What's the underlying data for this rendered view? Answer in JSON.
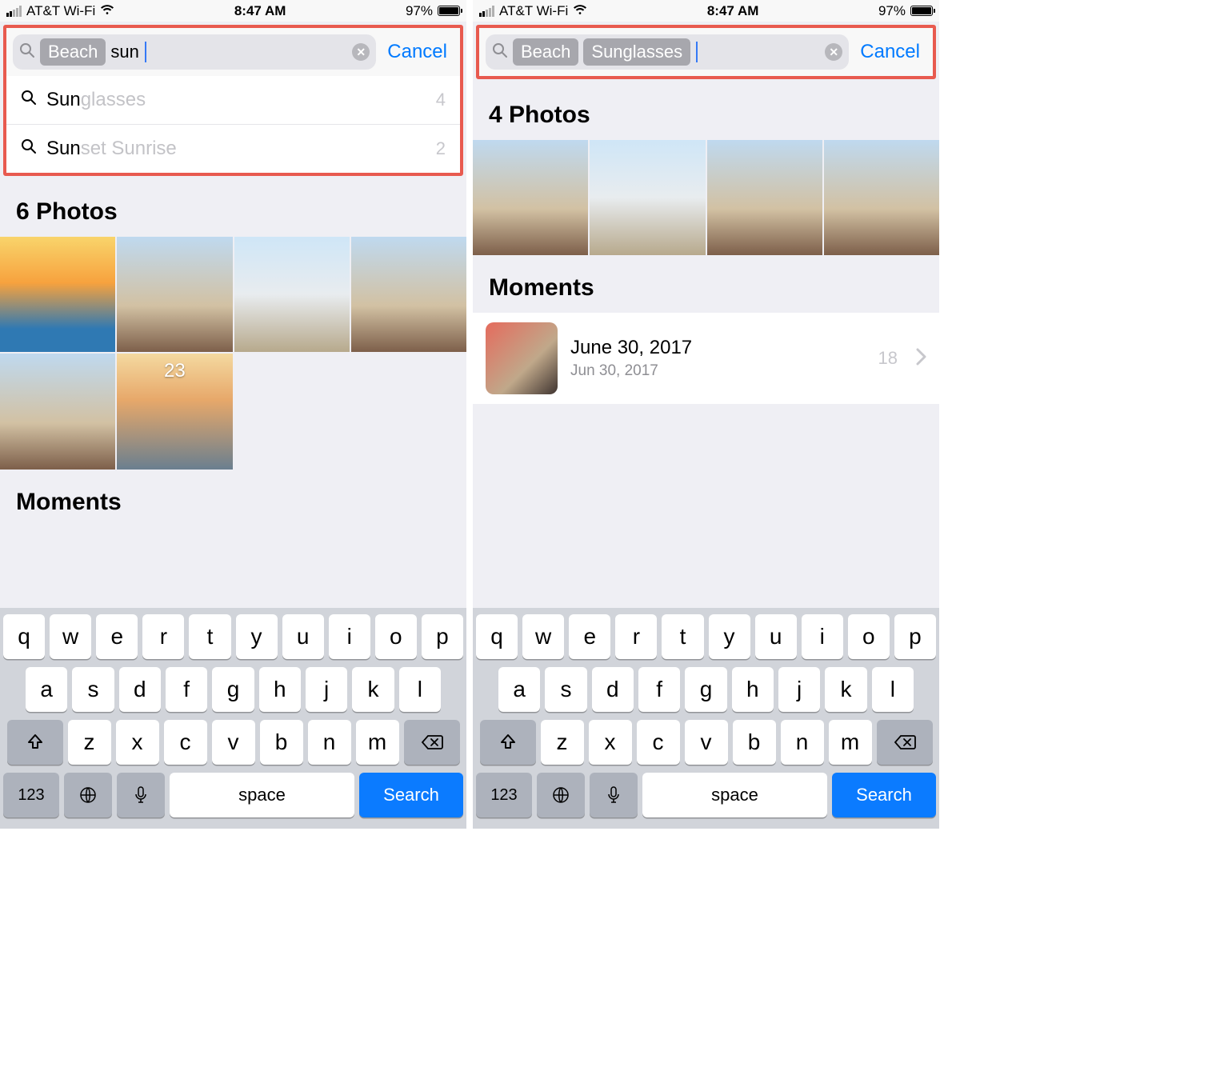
{
  "status": {
    "carrier": "AT&T Wi-Fi",
    "time": "8:47 AM",
    "battery_pct": "97%"
  },
  "left": {
    "search": {
      "tokens": [
        "Beach"
      ],
      "typed": "sun",
      "cancel": "Cancel"
    },
    "suggestions": [
      {
        "typed": "Sun",
        "completion": "glasses",
        "count": "4"
      },
      {
        "typed": "Sun",
        "completion": "set Sunrise",
        "count": "2"
      }
    ],
    "photos_heading": "6 Photos",
    "moments_heading": "Moments",
    "thumb_caption": "23"
  },
  "right": {
    "search": {
      "tokens": [
        "Beach",
        "Sunglasses"
      ],
      "typed": "",
      "cancel": "Cancel"
    },
    "photos_heading": "4 Photos",
    "moments_heading": "Moments",
    "moment": {
      "title": "June 30, 2017",
      "subtitle": "Jun 30, 2017",
      "count": "18"
    }
  },
  "keyboard": {
    "row1": [
      "q",
      "w",
      "e",
      "r",
      "t",
      "y",
      "u",
      "i",
      "o",
      "p"
    ],
    "row2": [
      "a",
      "s",
      "d",
      "f",
      "g",
      "h",
      "j",
      "k",
      "l"
    ],
    "row3": [
      "z",
      "x",
      "c",
      "v",
      "b",
      "n",
      "m"
    ],
    "num": "123",
    "space": "space",
    "search": "Search"
  }
}
